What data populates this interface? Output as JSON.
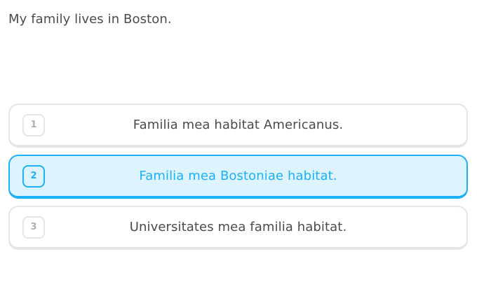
{
  "prompt": {
    "text": "My family lives in Boston."
  },
  "choices": [
    {
      "number": "1",
      "text": "Familia mea habitat Americanus.",
      "selected": false
    },
    {
      "number": "2",
      "text": "Familia mea Bostoniae habitat.",
      "selected": true
    },
    {
      "number": "3",
      "text": "Universitates mea familia habitat.",
      "selected": false
    }
  ],
  "colors": {
    "selected_border": "#1cb0f6",
    "selected_background": "#ddf4ff",
    "default_border": "#e5e5e5",
    "text": "#4b4b4b"
  }
}
